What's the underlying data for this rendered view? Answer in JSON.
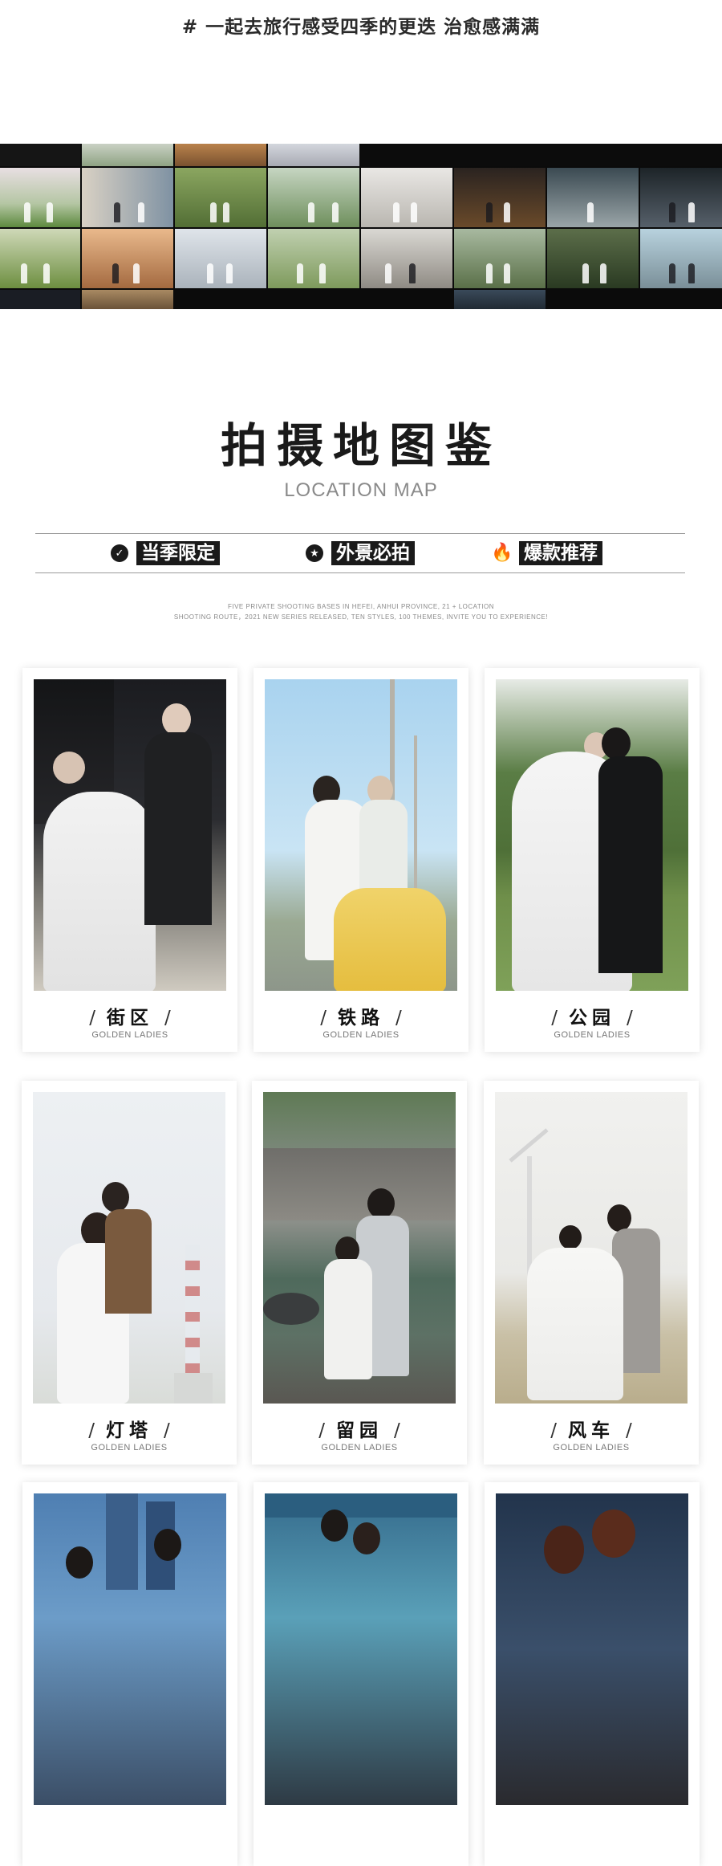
{
  "header": {
    "tagline": "# 一起去旅行感受四季的更迭 治愈感满满"
  },
  "collage": {
    "label": "wedding photo collage",
    "tile_count": 24
  },
  "section": {
    "title": "拍摄地图鉴",
    "subtitle": "LOCATION MAP",
    "tags": [
      {
        "icon": "check-circle-icon",
        "glyph": "✓",
        "label": "当季限定"
      },
      {
        "icon": "star-circle-icon",
        "glyph": "★",
        "label": "外景必拍"
      },
      {
        "icon": "flame-icon",
        "glyph": "🔥",
        "label": "爆款推荐"
      }
    ],
    "fine_line_1": "FIVE PRIVATE SHOOTING BASES IN HEFEI, ANHUI PROVINCE, 21 + LOCATION",
    "fine_line_2": "SHOOTING ROUTE，2021 NEW SERIES RELEASED, TEN STYLES, 100 THEMES, INVITE YOU TO EXPERIENCE!"
  },
  "locations": [
    {
      "name": "街区",
      "sub": "GOLDEN LADIES",
      "photo": "street-couple-photo"
    },
    {
      "name": "铁路",
      "sub": "GOLDEN LADIES",
      "photo": "railway-scooter-photo"
    },
    {
      "name": "公园",
      "sub": "GOLDEN LADIES",
      "photo": "park-couple-photo"
    },
    {
      "name": "灯塔",
      "sub": "GOLDEN LADIES",
      "photo": "lighthouse-couple-photo"
    },
    {
      "name": "留园",
      "sub": "GOLDEN LADIES",
      "photo": "garden-couple-photo"
    },
    {
      "name": "风车",
      "sub": "GOLDEN LADIES",
      "photo": "windmill-couple-photo"
    },
    {
      "name": "",
      "sub": "",
      "photo": "city-couple-photo"
    },
    {
      "name": "",
      "sub": "",
      "photo": "train-station-couple-photo"
    },
    {
      "name": "",
      "sub": "",
      "photo": "embrace-couple-photo"
    }
  ]
}
